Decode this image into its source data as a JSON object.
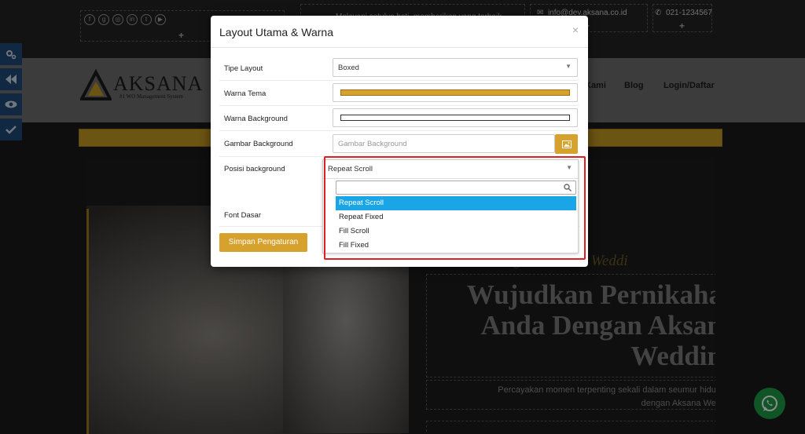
{
  "topbar": {
    "tagline": "Melayani setulus hati, memberikan yang terbaik",
    "email": "info@dev.aksana.co.id",
    "phone": "021-1234567",
    "social_icons": [
      "facebook-icon",
      "google-plus-icon",
      "instagram-icon",
      "linkedin-icon",
      "twitter-icon",
      "youtube-icon"
    ],
    "add_symbol": "+"
  },
  "navbar": {
    "logo_text": "AKSANA",
    "logo_sub": "#1 WO Management System",
    "items": [
      {
        "label": "Kami"
      },
      {
        "label": "Blog"
      },
      {
        "label": "Login/Daftar"
      }
    ]
  },
  "hero": {
    "welcome": "Selamat Datang Di Aksana Weddi",
    "headline": "Wujudkan Pernikaha\nAnda Dengan Aksan\nWeddin",
    "subline": "Percayakan momen terpenting sekali dalam seumur hidup\ndengan Aksana Wed"
  },
  "side_tools": [
    "gears-icon",
    "backward-icon",
    "eye-icon",
    "check-icon"
  ],
  "modal": {
    "title": "Layout Utama & Warna",
    "close": "×",
    "rows": {
      "layout_type": {
        "label": "Tipe Layout",
        "value": "Boxed"
      },
      "theme_color": {
        "label": "Warna Tema",
        "color": "#d6a12c"
      },
      "bg_color": {
        "label": "Warna Background",
        "color": "#ffffff"
      },
      "bg_image": {
        "label": "Gambar Background",
        "placeholder": "Gambar Background"
      },
      "bg_position": {
        "label": "Posisi background",
        "value": "Repeat Scroll",
        "options": [
          "Repeat Scroll",
          "Repeat Fixed",
          "Fill Scroll",
          "Fill Fixed"
        ],
        "highlighted": "Repeat Scroll"
      },
      "font": {
        "label": "Font Dasar"
      }
    },
    "save_label": "Simpan Pengaturan"
  },
  "colors": {
    "accent": "#d6a12c",
    "highlight": "#1aa6e6",
    "annotation": "#e11d26"
  }
}
